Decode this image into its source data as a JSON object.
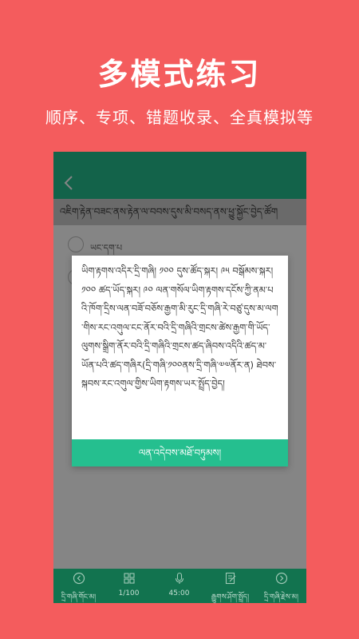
{
  "promo": {
    "title": "多模式练习",
    "subtitle": "顺序、专项、错题收录、全真模拟等"
  },
  "app": {
    "back_icon": "chevron-left-icon",
    "question": "འཇིག་རྟེན་བཟང་ནས་རྟེན་ལ་བབས་དུས་མི་བསད་ནས་ཕྱུ་སྐྱོང་བྱེད་ཚོག",
    "options": [
      {
        "label": "ཡང་དག་པ"
      },
      {
        "label": ""
      }
    ],
    "colors": {
      "background": "#f45c5d",
      "header": "#25bf8f",
      "bottom_bar": "#12734f"
    }
  },
  "dialog": {
    "text": "ཡིག་རྟགས་འདིར་དྲི་གཞི། ༡༠༠ དུས་ཚོད་སྐར། ༩༥ བསྒོམས་སྐར། ༡༠༠ ཚད་ཡོད་སྐར། ༩༠ ལན་གསོལ་ཡིག་རྟགས་དངོས་ཀྱི་ནམ་པའི་ཁོག་དྲིས་ལན་བཟོ་བཅོས་རྒྱག་མི་རུང་དྲི་གཞི་རེ་བཙུ་དུས་མ་ལག་གིས་རང་འགུལ་ངང་ནོར་བའི་དྲི་གཞིའི་གྲངས་ཚེས་རྒྱག་གི་ཡོད་ལུགས་སྒྲིག་ནོར་བའི་དྲི་གཞིའི་གྲངས་ཚད་ཞིབས་འདིའི་ཚད་མ་ཡོན་པའི་ཚད་གཞིར(དྲི་གཞི་༡༠༠ནས་དྲི་གཞི་༧༧ནོར་ན) ཐེབས་སྐབས་རང་འགུལ་གྱིས་ཡིག་རྟགས་ཡར་སྤྲོད་བྱེད།",
    "button_label": "ལན་འདེབས་མཐོ་བཏུམས།"
  },
  "bottom_nav": [
    {
      "icon": "chevron-left-circle-icon",
      "label": "དྲི་གཞི་གོང་མ།"
    },
    {
      "icon": "grid-icon",
      "label": "1/100"
    },
    {
      "icon": "microphone-icon",
      "label": "45:00"
    },
    {
      "icon": "edit-sheet-icon",
      "label": "རྒྱུགས་ཤོག་སྤྲོད།"
    },
    {
      "icon": "chevron-right-circle-icon",
      "label": "དྲི་གཞི་རྗེས་མ།"
    }
  ]
}
